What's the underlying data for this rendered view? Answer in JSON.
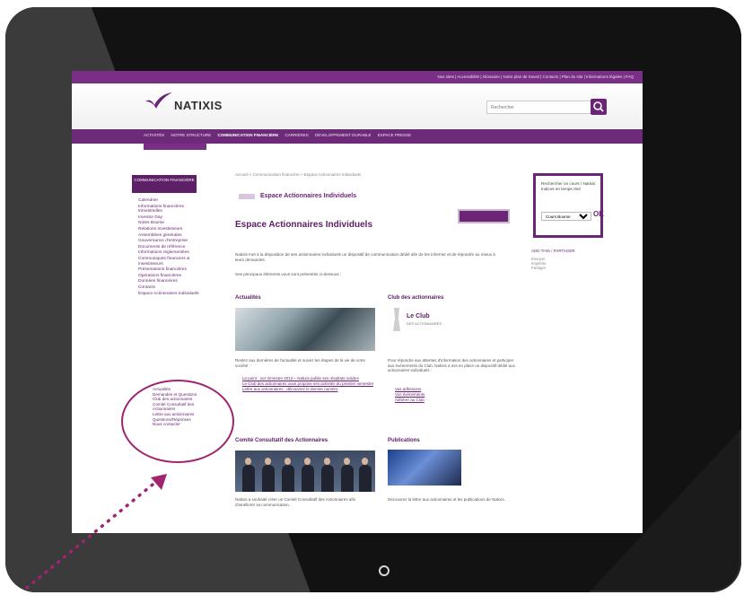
{
  "topbar": {
    "links": "Nos sites | Accessibilité | Glossaire | Notre plan de travail | Contacts | Plan du site | Informations légales | FAQ"
  },
  "header": {
    "logo_text": "NATIXIS",
    "search_placeholder": "Rechercher"
  },
  "navbar": {
    "items": [
      {
        "label": "ACTIVITÉS",
        "active": false
      },
      {
        "label": "NOTRE STRUCTURE",
        "active": false
      },
      {
        "label": "COMMUNICATION FINANCIÈRE",
        "active": true
      },
      {
        "label": "CARRIÈRES",
        "active": false
      },
      {
        "label": "DÉVELOPPEMENT DURABLE",
        "active": false
      },
      {
        "label": "ESPACE PRESSE",
        "active": false
      }
    ]
  },
  "sidebar": {
    "title": "COMMUNICATION FINANCIÈRE",
    "items": [
      "Calendrier",
      "Informations financières trimestrielles",
      "Investor Day",
      "Notes Bourse",
      "Relations Investisseurs",
      "Assemblées générales",
      "Gouvernance d'entreprise",
      "Documents de référence",
      "Informations réglementées",
      "Communiqués financiers & investisseurs",
      "Présentations financières",
      "Opérations financières",
      "Données financières",
      "Contacts",
      "Espace Actionnaires Individuels"
    ],
    "subitems": [
      "Actualités",
      "Demandes et Questions",
      "Club des actionnaires",
      "Comité Consultatif des Actionnaires",
      "Lettre aux actionnaires",
      "Questions/Réponses",
      "Nous contacter"
    ]
  },
  "content": {
    "breadcrumb": "Accueil > Communication financière > Espace Actionnaires Individuels",
    "section_title": "Espace Actionnaires Individuels",
    "page_title": "Espace Actionnaires Individuels",
    "intro": "Natixis met à la disposition de ses actionnaires individuels un dispositif de communication dédié afin de les informer et de répondre au mieux à leurs demandes.",
    "intro2": "Ses principaux éléments vous sont présentés ci-dessous :",
    "actualites": {
      "heading": "Actualités",
      "text": "Restez aux dernières de l'actualité et suivez les étapes de la vie de votre société :",
      "links": [
        "Le point : 1er trimestre 2013 – Natixis publie ses résultats solides",
        "Le Club des actionnaires vous propose ses activités du premier semestre",
        "Lettre aux actionnaires : découvrez le dernier numéro"
      ]
    },
    "club": {
      "heading": "Club des actionnaires",
      "badge_label": "Le Club",
      "badge_sub": "DES ACTIONNAIRES",
      "text": "Pour répondre aux attentes d'information des actionnaires et participer aux événements du Club, Natixis a mis en place un dispositif dédié aux actionnaires individuels :",
      "links": [
        "Vos adhésions",
        "Vos événements",
        "Adhérer au Club"
      ]
    },
    "comite": {
      "heading": "Comité Consultatif des Actionnaires",
      "text": "Natixis a souhaité créer un Comité Consultatif des Actionnaires afin d'améliorer sa communication."
    },
    "publications": {
      "heading": "Publications",
      "text": "Découvrez la lettre aux actionnaires et les publications de Natixis."
    }
  },
  "right_box": {
    "text": "Rechercher un cours / Natixis Indices en temps réel",
    "select_value": "Cours Bourse",
    "ok_label": "OK"
  },
  "share": {
    "label": "ADD THIS / PARTAGER",
    "small": [
      "Envoyer",
      "Imprimer",
      "Partager"
    ]
  },
  "colors": {
    "brand_purple": "#6a2577",
    "topbar_purple": "#7a2f86",
    "highlight": "#a0246f"
  }
}
